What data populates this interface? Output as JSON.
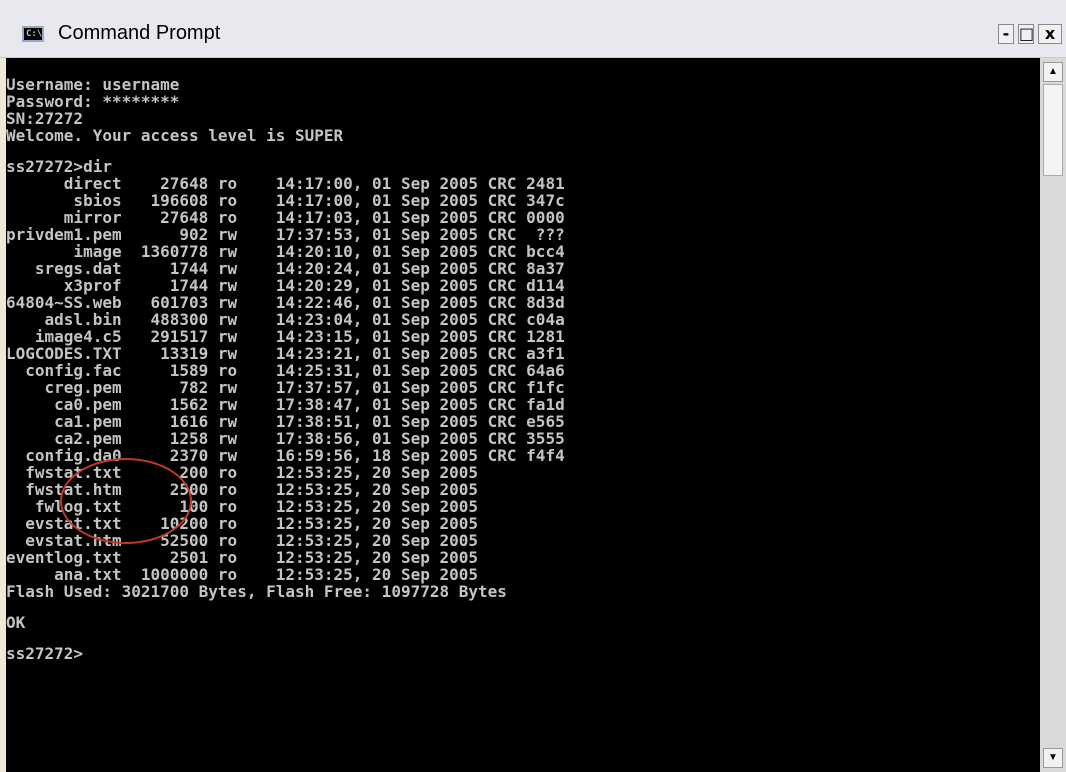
{
  "window": {
    "title": "Command Prompt",
    "icon_text": "C:\\",
    "minimize_label": "-",
    "maximize_label": "□",
    "close_label": "x"
  },
  "scroll": {
    "up": "▲",
    "down": "▼"
  },
  "console": {
    "lines": [
      "Username: username",
      "Password: ********",
      "SN:27272",
      "Welcome. Your access level is SUPER",
      "",
      "ss27272>dir",
      "      direct    27648 ro    14:17:00, 01 Sep 2005 CRC 2481",
      "       sbios   196608 ro    14:17:00, 01 Sep 2005 CRC 347c",
      "      mirror    27648 ro    14:17:03, 01 Sep 2005 CRC 0000",
      "privdem1.pem      902 rw    17:37:53, 01 Sep 2005 CRC  ???",
      "       image  1360778 rw    14:20:10, 01 Sep 2005 CRC bcc4",
      "   sregs.dat     1744 rw    14:20:24, 01 Sep 2005 CRC 8a37",
      "      x3prof     1744 rw    14:20:29, 01 Sep 2005 CRC d114",
      "64804~SS.web   601703 rw    14:22:46, 01 Sep 2005 CRC 8d3d",
      "    adsl.bin   488300 rw    14:23:04, 01 Sep 2005 CRC c04a",
      "   image4.c5   291517 rw    14:23:15, 01 Sep 2005 CRC 1281",
      "LOGCODES.TXT    13319 rw    14:23:21, 01 Sep 2005 CRC a3f1",
      "  config.fac     1589 ro    14:25:31, 01 Sep 2005 CRC 64a6",
      "    creg.pem      782 rw    17:37:57, 01 Sep 2005 CRC f1fc",
      "     ca0.pem     1562 rw    17:38:47, 01 Sep 2005 CRC fa1d",
      "     ca1.pem     1616 rw    17:38:51, 01 Sep 2005 CRC e565",
      "     ca2.pem     1258 rw    17:38:56, 01 Sep 2005 CRC 3555",
      "  config.da0     2370 rw    16:59:56, 18 Sep 2005 CRC f4f4",
      "  fwstat.txt      200 ro    12:53:25, 20 Sep 2005",
      "  fwstat.htm     2500 ro    12:53:25, 20 Sep 2005",
      "   fwlog.txt      100 ro    12:53:25, 20 Sep 2005",
      "  evstat.txt    10200 ro    12:53:25, 20 Sep 2005",
      "  evstat.htm    52500 ro    12:53:25, 20 Sep 2005",
      "eventlog.txt     2501 ro    12:53:25, 20 Sep 2005",
      "     ana.txt  1000000 ro    12:53:25, 20 Sep 2005",
      "Flash Used: 3021700 Bytes, Flash Free: 1097728 Bytes",
      "",
      "OK",
      "",
      "ss27272>"
    ]
  },
  "colors": {
    "console_bg": "#000000",
    "console_text": "#c4c4c4",
    "annotation": "#c0392b"
  }
}
